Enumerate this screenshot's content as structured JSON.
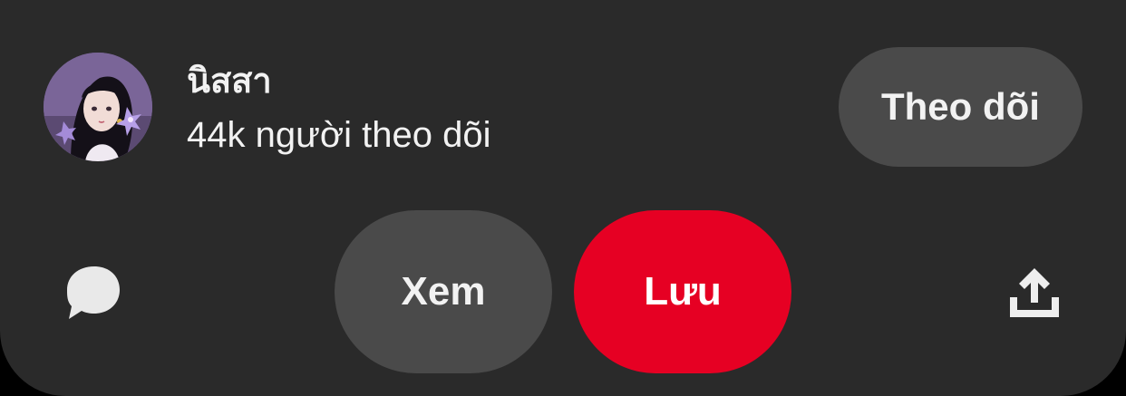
{
  "profile": {
    "name": "นิสสา",
    "followers": "44k người theo dõi"
  },
  "actions": {
    "follow_label": "Theo dõi",
    "view_label": "Xem",
    "save_label": "Lưu"
  },
  "icons": {
    "comment": "comment-bubble-icon",
    "share": "share-upload-icon"
  },
  "colors": {
    "panel_bg": "#2a2a2a",
    "secondary_button": "#4a4a4a",
    "primary_button": "#e60023",
    "text": "#f2f2f2"
  }
}
